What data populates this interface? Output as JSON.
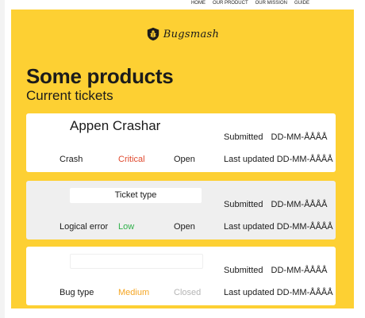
{
  "nav": {
    "links": [
      "HOME",
      "OUR PRODUCT",
      "OUR MISSION",
      "GUIDE"
    ]
  },
  "brand": {
    "name": "Bugsmash",
    "icon": "bug-shield-icon"
  },
  "page": {
    "title": "Some products",
    "subtitle": "Current tickets"
  },
  "colors": {
    "background": "#fdd033",
    "critical": "#e04a2f",
    "low": "#2fb04a",
    "medium": "#f5a623",
    "closed": "#b5b5b5"
  },
  "tickets": [
    {
      "title": "Appen Crashar",
      "type": "Crash",
      "severity": "Critical",
      "status": "Open",
      "submitted_label": "Submitted",
      "submitted_date": "DD-MM-ÅÅÅÅ",
      "updated_label": "Last updated",
      "updated_date": "DD-MM-ÅÅÅÅ"
    },
    {
      "field": "Ticket type",
      "type": "Logical error",
      "severity": "Low",
      "status": "Open",
      "submitted_label": "Submitted",
      "submitted_date": "DD-MM-ÅÅÅÅ",
      "updated_label": "Last updated",
      "updated_date": "DD-MM-ÅÅÅÅ"
    },
    {
      "field": "",
      "type": "Bug type",
      "severity": "Medium",
      "status": "Closed",
      "submitted_label": "Submitted",
      "submitted_date": "DD-MM-ÅÅÅÅ",
      "updated_label": "Last updated",
      "updated_date": "DD-MM-ÅÅÅÅ"
    }
  ]
}
